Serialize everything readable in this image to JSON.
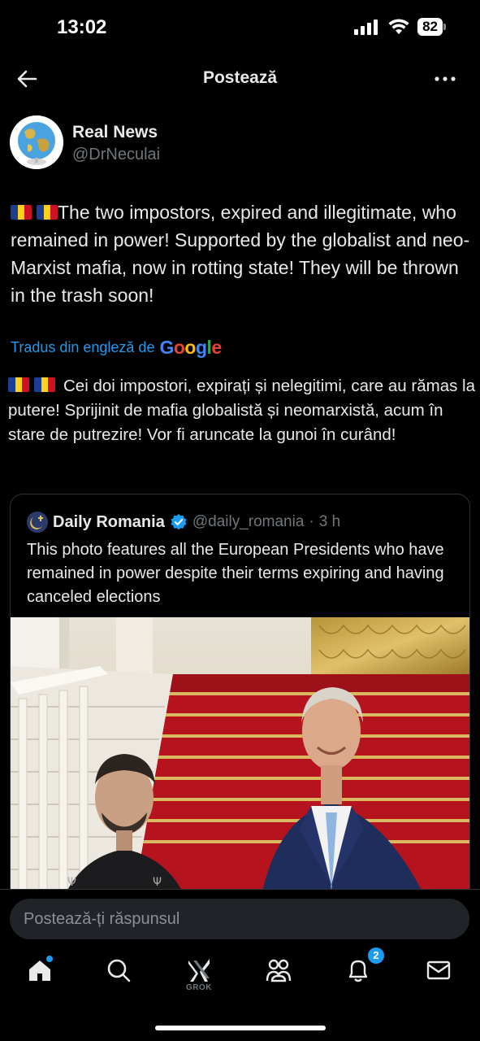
{
  "status_bar": {
    "time": "13:02",
    "battery": "82"
  },
  "header": {
    "title": "Postează",
    "back_icon": "arrow-left-icon",
    "more_icon": "more-horizontal-icon"
  },
  "post": {
    "author_name": "Real News",
    "author_handle": "@DrNeculai",
    "text": "The two impostors, expired and illegitimate, who remained in power! Supported by the globalist and neo-Marxist mafia, now in rotting state! They will be thrown in the trash soon!",
    "translated_by_label": "Tradus din engleză de",
    "translated_by_brand": "Google",
    "translated_text": "Cei doi impostori, expirați și nelegitimi, care au rămas la putere! Sprijinit de mafia globalistă și neomarxistă, acum în stare de putrezire! Vor fi aruncate la gunoi în curând!"
  },
  "quote": {
    "name": "Daily Romania",
    "handle": "@daily_romania",
    "separator": "·",
    "time": "3 h",
    "text": "This photo features all the European Presidents who have remained in power despite their terms expiring and having canceled elections",
    "verified_icon": "verified-badge-icon"
  },
  "reply": {
    "placeholder": "Postează-ți răspunsul"
  },
  "nav": {
    "grok_label": "GROK",
    "notifications_count": "2"
  },
  "colors": {
    "background": "#000000",
    "text_primary": "#e7e9ea",
    "text_secondary": "#71767b",
    "accent": "#1d9bf0",
    "border": "#2f3336"
  }
}
